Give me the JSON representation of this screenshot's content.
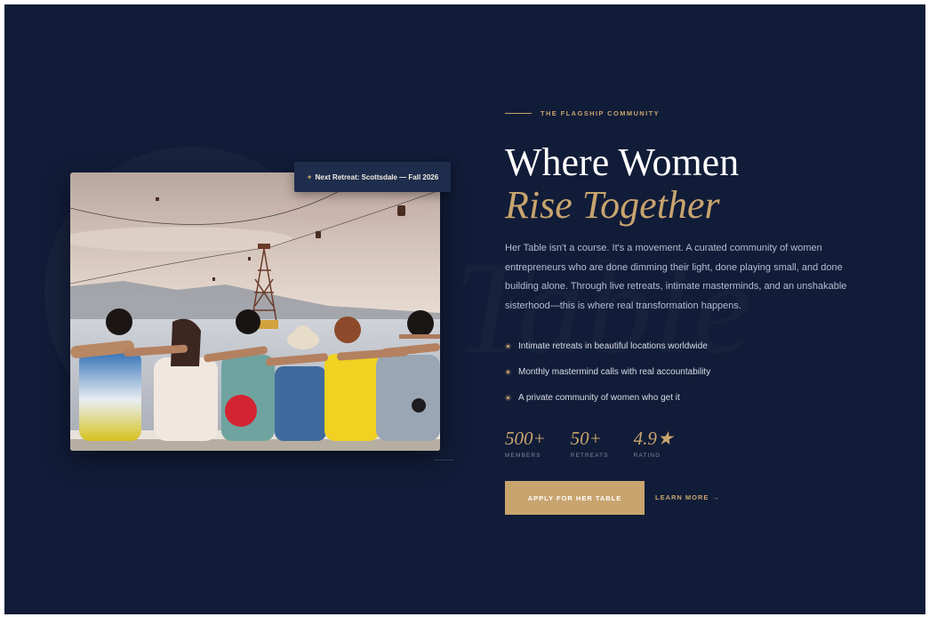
{
  "badge": {
    "icon": "star-icon",
    "text": "Next Retreat: Scottsdale — Fall 2026"
  },
  "eyebrow": "THE FLAGSHIP COMMUNITY",
  "headline": {
    "line1": "Where Women",
    "line2": "Rise Together"
  },
  "body": "Her Table isn't a course. It's a movement. A curated community of women entrepreneurs who are done dimming their light, done playing small, and done building alone. Through live retreats, intimate masterminds, and an unshakable sisterhood—this is where real transformation happens.",
  "bullets": [
    "Intimate retreats in beautiful locations worldwide",
    "Monthly mastermind calls with real accountability",
    "A private community of women who get it"
  ],
  "stats": [
    {
      "value": "500+",
      "label": "MEMBERS"
    },
    {
      "value": "50+",
      "label": "RETREATS"
    },
    {
      "value": "4.9★",
      "label": "RATING"
    }
  ],
  "cta": {
    "primary": "APPLY FOR HER TABLE",
    "secondary": "LEARN MORE",
    "arrow": "→"
  },
  "colors": {
    "background": "#111c38",
    "accent": "#c8a46e",
    "badge_bg": "#1f2d4d"
  }
}
